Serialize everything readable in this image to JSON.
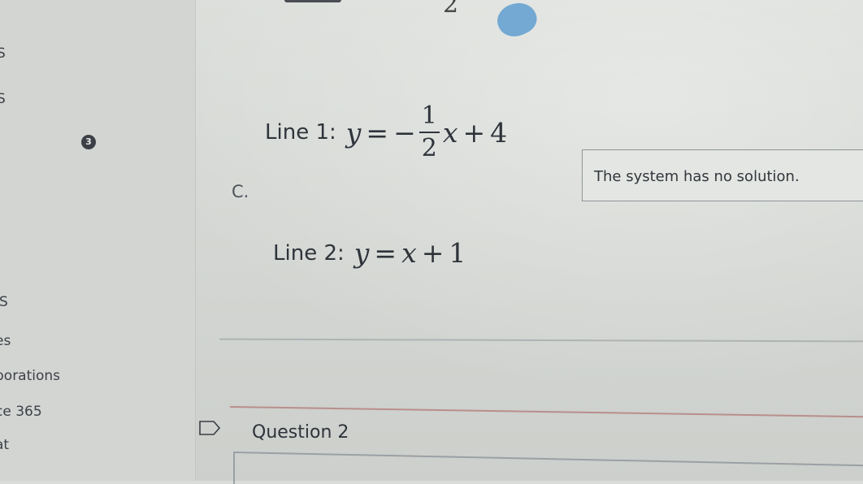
{
  "sidebar": {
    "items": [
      {
        "label": "S"
      },
      {
        "label": "S"
      },
      {
        "label": "IS"
      },
      {
        "label": "es"
      },
      {
        "label": "borations"
      },
      {
        "label": "ce 365"
      },
      {
        "label": "at"
      }
    ]
  },
  "top": {
    "partial_digit": "2"
  },
  "question": {
    "number": "3",
    "option_letter": "C.",
    "line1": {
      "label": "Line 1:",
      "lhs": "y",
      "eq": "=",
      "sign": "−",
      "numerator": "1",
      "denominator": "2",
      "var": "x",
      "plus": "+",
      "constant": "4"
    },
    "line2": {
      "label": "Line 2:",
      "lhs": "y",
      "eq": "=",
      "var": "x",
      "plus": "+",
      "constant": "1"
    },
    "answer_text": "The system has no solution."
  },
  "next_question": {
    "title": "Question 2",
    "icon": "flag-icon"
  },
  "colors": {
    "background": "#d9dcd8",
    "text": "#2f343b",
    "accent_blob": "#5f9fcf",
    "question_rule": "#b98e8c"
  }
}
